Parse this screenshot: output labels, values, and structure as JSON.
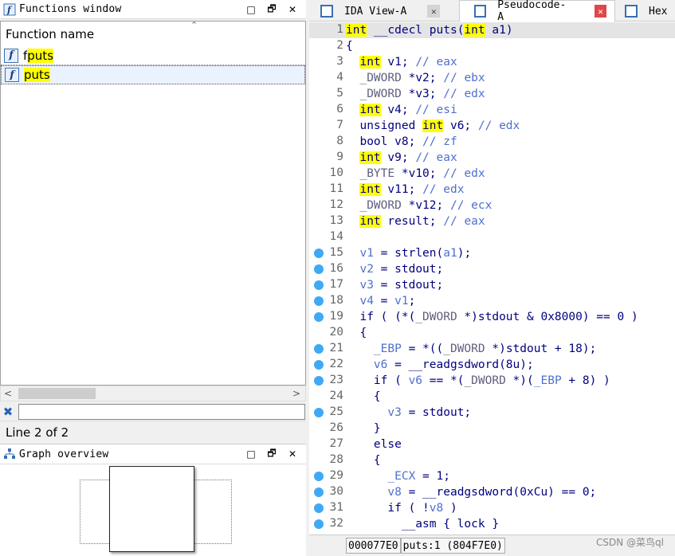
{
  "functions_window": {
    "title": "Functions window",
    "column_header": "Function name",
    "items": [
      {
        "icon": "function-icon",
        "name_prefix": "f",
        "name_highlight": "puts"
      },
      {
        "icon": "function-icon",
        "name_prefix": "",
        "name_highlight": "puts"
      }
    ],
    "status": "Line 2 of 2"
  },
  "graph_overview": {
    "title": "Graph overview"
  },
  "tabs": [
    {
      "label": "IDA View-A",
      "icon": "ida-view-icon",
      "active": false
    },
    {
      "label": "Pseudocode-A",
      "icon": "pseudocode-icon",
      "active": true
    },
    {
      "label": "Hex",
      "icon": "hex-view-icon",
      "active": false
    }
  ],
  "code": {
    "lines": [
      {
        "n": "1",
        "dot": false,
        "html": "<span class='c-hl'>int</span> __cdecl puts(<span class='c-hl'>int</span> a1)"
      },
      {
        "n": "2",
        "dot": false,
        "html": "{"
      },
      {
        "n": "3",
        "dot": false,
        "html": "  <span class='c-hl'>int</span> v1; <span class='c-cmt'>// eax</span>"
      },
      {
        "n": "4",
        "dot": false,
        "html": "  <span class='c-type'>_DWORD</span> *v2; <span class='c-cmt'>// ebx</span>"
      },
      {
        "n": "5",
        "dot": false,
        "html": "  <span class='c-type'>_DWORD</span> *v3; <span class='c-cmt'>// edx</span>"
      },
      {
        "n": "6",
        "dot": false,
        "html": "  <span class='c-hl'>int</span> v4; <span class='c-cmt'>// esi</span>"
      },
      {
        "n": "7",
        "dot": false,
        "html": "  unsigned <span class='c-hl'>int</span> v6; <span class='c-cmt'>// edx</span>"
      },
      {
        "n": "8",
        "dot": false,
        "html": "  bool v8; <span class='c-cmt'>// zf</span>"
      },
      {
        "n": "9",
        "dot": false,
        "html": "  <span class='c-hl'>int</span> v9; <span class='c-cmt'>// eax</span>"
      },
      {
        "n": "10",
        "dot": false,
        "html": "  <span class='c-type'>_BYTE</span> *v10; <span class='c-cmt'>// edx</span>"
      },
      {
        "n": "11",
        "dot": false,
        "html": "  <span class='c-hl'>int</span> v11; <span class='c-cmt'>// edx</span>"
      },
      {
        "n": "12",
        "dot": false,
        "html": "  <span class='c-type'>_DWORD</span> *v12; <span class='c-cmt'>// ecx</span>"
      },
      {
        "n": "13",
        "dot": false,
        "html": "  <span class='c-hl'>int</span> result; <span class='c-cmt'>// eax</span>"
      },
      {
        "n": "14",
        "dot": false,
        "html": ""
      },
      {
        "n": "15",
        "dot": true,
        "html": "  <span class='c-var'>v1</span> = strlen(<span class='c-var'>a1</span>);"
      },
      {
        "n": "16",
        "dot": true,
        "html": "  <span class='c-var'>v2</span> = stdout;"
      },
      {
        "n": "17",
        "dot": true,
        "html": "  <span class='c-var'>v3</span> = stdout;"
      },
      {
        "n": "18",
        "dot": true,
        "html": "  <span class='c-var'>v4</span> = <span class='c-var'>v1</span>;"
      },
      {
        "n": "19",
        "dot": true,
        "html": "  if ( (*(<span class='c-type'>_DWORD</span> *)stdout &amp; 0x8000) == 0 )"
      },
      {
        "n": "20",
        "dot": false,
        "html": "  {"
      },
      {
        "n": "21",
        "dot": true,
        "html": "    <span class='c-var'>_EBP</span> = *((<span class='c-type'>_DWORD</span> *)stdout + 18);"
      },
      {
        "n": "22",
        "dot": true,
        "html": "    <span class='c-var'>v6</span> = __readgsdword(8u);"
      },
      {
        "n": "23",
        "dot": true,
        "html": "    if ( <span class='c-var'>v6</span> == *(<span class='c-type'>_DWORD</span> *)(<span class='c-var'>_EBP</span> + 8) )"
      },
      {
        "n": "24",
        "dot": false,
        "html": "    {"
      },
      {
        "n": "25",
        "dot": true,
        "html": "      <span class='c-var'>v3</span> = stdout;"
      },
      {
        "n": "26",
        "dot": false,
        "html": "    }"
      },
      {
        "n": "27",
        "dot": false,
        "html": "    else"
      },
      {
        "n": "28",
        "dot": false,
        "html": "    {"
      },
      {
        "n": "29",
        "dot": true,
        "html": "      <span class='c-var'>_ECX</span> = 1;"
      },
      {
        "n": "30",
        "dot": true,
        "html": "      <span class='c-var'>v8</span> = __readgsdword(0xCu) == 0;"
      },
      {
        "n": "31",
        "dot": true,
        "html": "      if ( !<span class='c-var'>v8</span> )"
      },
      {
        "n": "32",
        "dot": true,
        "html": "        __asm { lock }"
      }
    ]
  },
  "status_bar": {
    "address": "000077E0",
    "location": "puts:1 (804F7E0)"
  },
  "watermark": "CSDN @菜鸟ql",
  "colors": {
    "highlight": "#ffff00",
    "breakpoint_dot": "#3fa9f5",
    "keyword": "#000080",
    "variable": "#4f6fd0"
  }
}
